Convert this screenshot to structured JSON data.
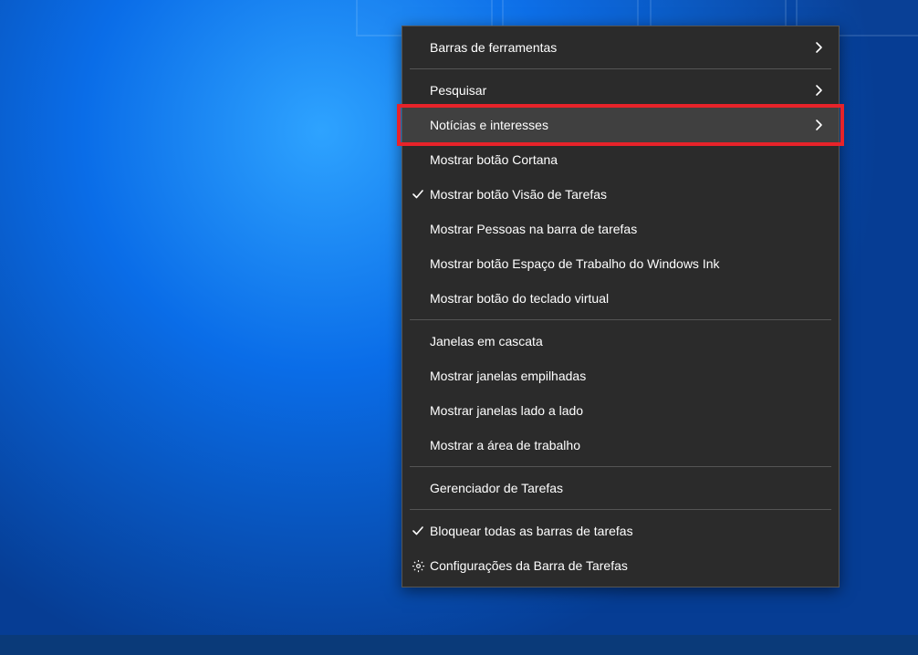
{
  "menu": {
    "items": [
      {
        "label": "Barras de ferramentas",
        "submenu": true,
        "checked": false,
        "icon": null
      },
      {
        "sep": true
      },
      {
        "label": "Pesquisar",
        "submenu": true,
        "checked": false,
        "icon": null
      },
      {
        "label": "Notícias e interesses",
        "submenu": true,
        "checked": false,
        "icon": null,
        "highlighted": true
      },
      {
        "label": "Mostrar botão Cortana",
        "submenu": false,
        "checked": false,
        "icon": null
      },
      {
        "label": "Mostrar botão Visão de Tarefas",
        "submenu": false,
        "checked": true,
        "icon": null
      },
      {
        "label": "Mostrar Pessoas na barra de tarefas",
        "submenu": false,
        "checked": false,
        "icon": null
      },
      {
        "label": "Mostrar botão Espaço de Trabalho do Windows Ink",
        "submenu": false,
        "checked": false,
        "icon": null
      },
      {
        "label": "Mostrar botão do teclado virtual",
        "submenu": false,
        "checked": false,
        "icon": null
      },
      {
        "sep": true
      },
      {
        "label": "Janelas em cascata",
        "submenu": false,
        "checked": false,
        "icon": null
      },
      {
        "label": "Mostrar janelas empilhadas",
        "submenu": false,
        "checked": false,
        "icon": null
      },
      {
        "label": "Mostrar janelas lado a lado",
        "submenu": false,
        "checked": false,
        "icon": null
      },
      {
        "label": "Mostrar a área de trabalho",
        "submenu": false,
        "checked": false,
        "icon": null
      },
      {
        "sep": true
      },
      {
        "label": "Gerenciador de Tarefas",
        "submenu": false,
        "checked": false,
        "icon": null
      },
      {
        "sep": true
      },
      {
        "label": "Bloquear todas as barras de tarefas",
        "submenu": false,
        "checked": true,
        "icon": null
      },
      {
        "label": "Configurações da Barra de Tarefas",
        "submenu": false,
        "checked": false,
        "icon": "gear-icon"
      }
    ]
  },
  "highlight_target_index": 3
}
